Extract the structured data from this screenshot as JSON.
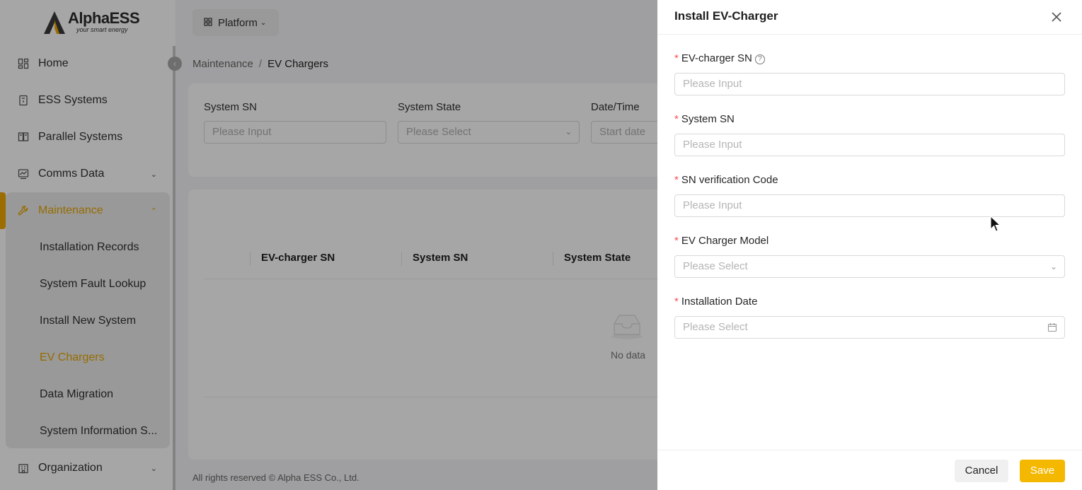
{
  "brand": {
    "name": "AlphaESS",
    "tagline": "your smart energy"
  },
  "topbar": {
    "platform_label": "Platform"
  },
  "sidebar": {
    "items": [
      {
        "label": "Home",
        "icon": "home-icon"
      },
      {
        "label": "ESS Systems",
        "icon": "ess-icon"
      },
      {
        "label": "Parallel Systems",
        "icon": "parallel-icon"
      },
      {
        "label": "Comms Data",
        "icon": "chart-icon"
      },
      {
        "label": "Maintenance",
        "icon": "wrench-icon"
      },
      {
        "label": "Organization",
        "icon": "building-icon"
      }
    ],
    "maintenance_sub": [
      "Installation Records",
      "System Fault Lookup",
      "Install New System",
      "EV Chargers",
      "Data Migration",
      "System Information S..."
    ]
  },
  "breadcrumb": {
    "parent": "Maintenance",
    "separator": "/",
    "current": "EV Chargers"
  },
  "filters": {
    "system_sn": {
      "label": "System SN",
      "placeholder": "Please Input"
    },
    "system_state": {
      "label": "System State",
      "placeholder": "Please Select"
    },
    "date_time": {
      "label": "Date/Time",
      "placeholder": "Start date"
    }
  },
  "table": {
    "columns": [
      "EV-charger SN",
      "System SN",
      "System State"
    ],
    "empty_text": "No data"
  },
  "footer": {
    "copyright": "All rights reserved © Alpha ESS Co., Ltd."
  },
  "drawer": {
    "title": "Install EV-Charger",
    "fields": [
      {
        "label": "EV-charger SN",
        "placeholder": "Please Input"
      },
      {
        "label": "System SN",
        "placeholder": "Please Input"
      },
      {
        "label": "SN verification Code",
        "placeholder": "Please Input"
      },
      {
        "label": "EV Charger Model",
        "placeholder": "Please Select"
      },
      {
        "label": "Installation Date",
        "placeholder": "Please Select"
      }
    ],
    "required_mark": "*",
    "cancel_label": "Cancel",
    "save_label": "Save"
  },
  "colors": {
    "accent": "#f5b800",
    "active_text": "#e6a600",
    "required": "#ff4d4f"
  }
}
